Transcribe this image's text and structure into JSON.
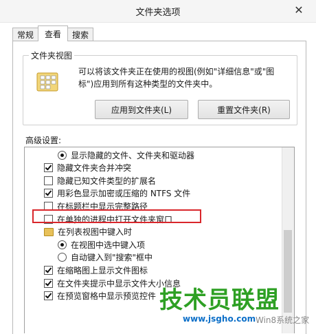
{
  "window": {
    "title": "文件夹选项",
    "close_glyph": "✕"
  },
  "tabs": [
    "常规",
    "查看",
    "搜索"
  ],
  "folder_views": {
    "title": "文件夹视图",
    "description": "可以将该文件夹正在使用的视图(例如\"详细信息\"或\"图标\")应用到所有这种类型的文件夹中。",
    "apply_button": "应用到文件夹(L)",
    "reset_button": "重置文件夹(R)"
  },
  "advanced": {
    "label": "高级设置:",
    "items": [
      {
        "kind": "radio",
        "checked": true,
        "indent": 1,
        "text": "显示隐藏的文件、文件夹和驱动器"
      },
      {
        "kind": "checkbox",
        "checked": true,
        "indent": 0,
        "text": "隐藏文件夹合并冲突"
      },
      {
        "kind": "checkbox",
        "checked": false,
        "indent": 0,
        "text": "隐藏已知文件类型的扩展名"
      },
      {
        "kind": "checkbox",
        "checked": true,
        "indent": 0,
        "text": "用彩色显示加密或压缩的 NTFS 文件"
      },
      {
        "kind": "checkbox",
        "checked": false,
        "indent": 0,
        "text": "在标题栏中显示完整路径"
      },
      {
        "kind": "checkbox",
        "checked": false,
        "indent": 0,
        "text": "在单独的进程中打开文件夹窗口"
      },
      {
        "kind": "folder",
        "checked": false,
        "indent": 0,
        "text": "在列表视图中键入时"
      },
      {
        "kind": "radio",
        "checked": true,
        "indent": 1,
        "text": "在视图中选中键入项"
      },
      {
        "kind": "radio",
        "checked": false,
        "indent": 1,
        "text": "自动键入到\"搜索\"框中"
      },
      {
        "kind": "checkbox",
        "checked": true,
        "indent": 0,
        "text": "在缩略图上显示文件图标"
      },
      {
        "kind": "checkbox",
        "checked": true,
        "indent": 0,
        "text": "在文件夹提示中显示文件大小信息"
      },
      {
        "kind": "checkbox",
        "checked": true,
        "indent": 0,
        "text": "在预览窗格中显示预览控件"
      }
    ]
  },
  "watermark": {
    "main": "技术员联盟",
    "site": "www.jsgho.com",
    "extra": "Win8系统之家"
  },
  "colors": {
    "highlight": "#d9262b",
    "watermark_green": "#2ea024",
    "watermark_blue": "#0c6fc8"
  }
}
